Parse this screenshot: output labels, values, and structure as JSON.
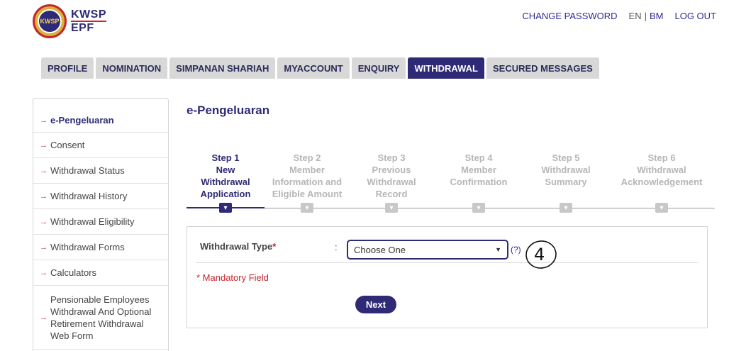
{
  "logo": {
    "line1": "KWSP",
    "line2": "EPF",
    "badge_text": "KWSP"
  },
  "top_links": {
    "change_password": "CHANGE PASSWORD",
    "lang_en": "EN",
    "lang_sep": "|",
    "lang_bm": "BM",
    "logout": "LOG OUT"
  },
  "tabs": [
    {
      "label": "PROFILE"
    },
    {
      "label": "NOMINATION"
    },
    {
      "label": "SIMPANAN SHARIAH"
    },
    {
      "label": "MYACCOUNT"
    },
    {
      "label": "ENQUIRY"
    },
    {
      "label": "WITHDRAWAL",
      "active": true
    },
    {
      "label": "SECURED MESSAGES"
    }
  ],
  "sidebar": {
    "arrow_glyph": "→",
    "items": [
      {
        "label": "e-Pengeluaran",
        "active": true
      },
      {
        "label": "Consent"
      },
      {
        "label": "Withdrawal Status"
      },
      {
        "label": "Withdrawal History"
      },
      {
        "label": "Withdrawal Eligibility"
      },
      {
        "label": "Withdrawal Forms"
      },
      {
        "label": "Calculators"
      },
      {
        "label": "Pensionable Employees Withdrawal And Optional Retirement Withdrawal Web Form"
      }
    ]
  },
  "page_title": "e-Pengeluaran",
  "steps": [
    {
      "line1": "Step 1",
      "line2": "New",
      "line3": "Withdrawal",
      "line4": "Application",
      "active": true
    },
    {
      "line1": "Step 2",
      "line2": "Member",
      "line3": "Information and",
      "line4": "Eligible Amount"
    },
    {
      "line1": "Step 3",
      "line2": "Previous",
      "line3": "Withdrawal",
      "line4": "Record"
    },
    {
      "line1": "Step 4",
      "line2": "Member",
      "line3": "Confirmation",
      "line4": ""
    },
    {
      "line1": "Step 5",
      "line2": "Withdrawal",
      "line3": "Summary",
      "line4": ""
    },
    {
      "line1": "Step 6",
      "line2": "Withdrawal",
      "line3": "Acknowledgement",
      "line4": ""
    }
  ],
  "form": {
    "withdrawal_type_label": "Withdrawal Type",
    "required_mark": "*",
    "colon": ":",
    "select_value": "Choose One",
    "help": "(?)",
    "mandatory_note": "* Mandatory Field",
    "next_label": "Next"
  },
  "annotation": {
    "text": "4"
  },
  "colors": {
    "brand": "#2e2a75",
    "accent_red": "#c4262e",
    "tab_bg": "#d8d8d8",
    "step_inactive": "#b6b6b6"
  }
}
